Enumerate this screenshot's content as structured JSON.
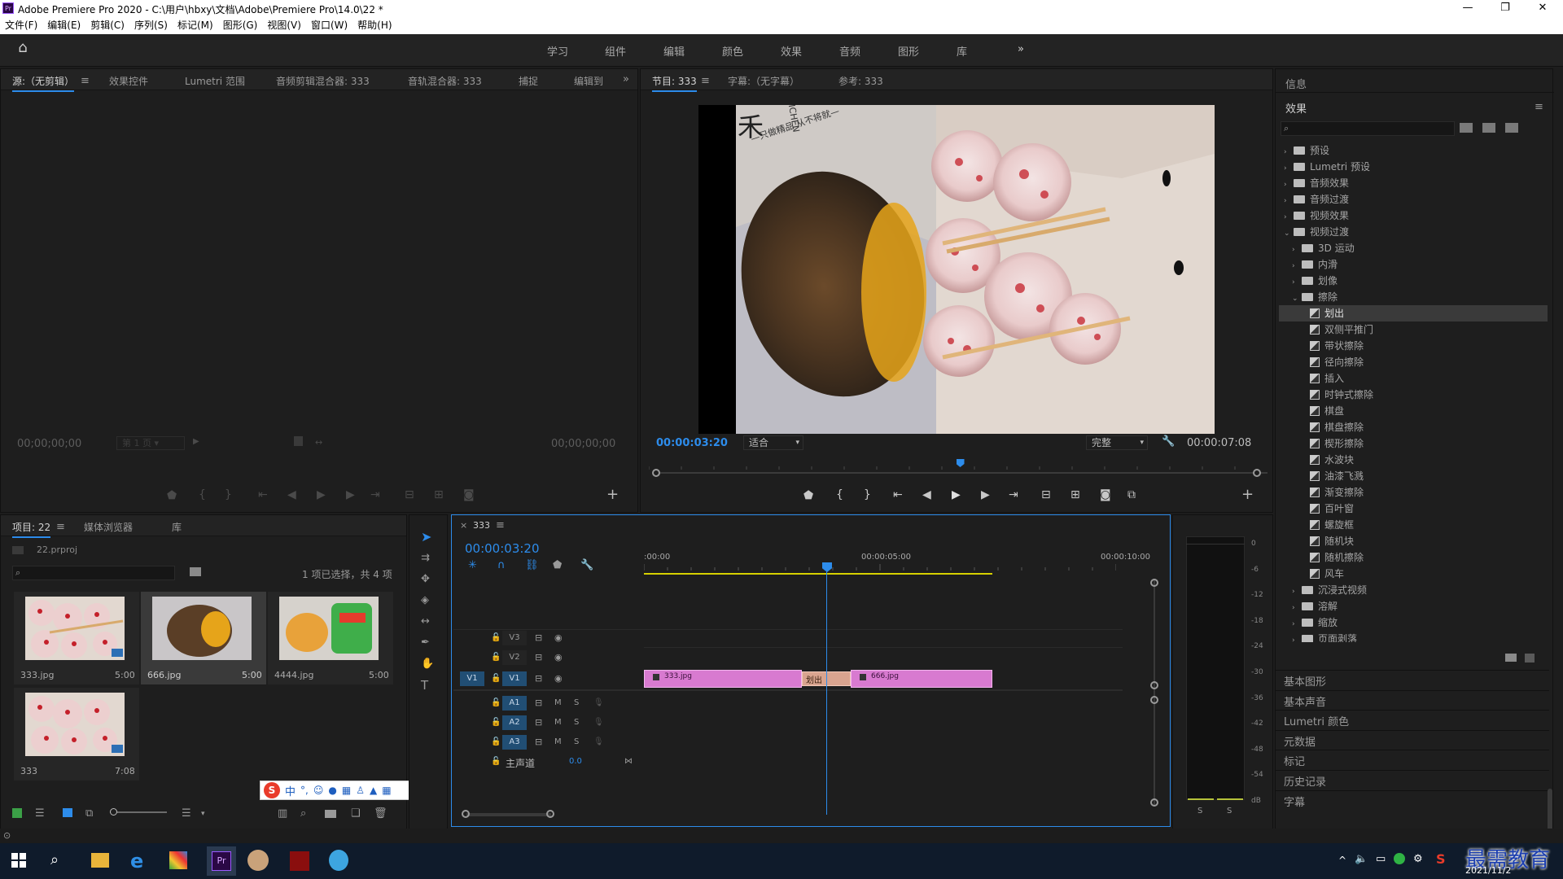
{
  "window": {
    "title": "Adobe Premiere Pro 2020 - C:\\用户\\hbxy\\文档\\Adobe\\Premiere Pro\\14.0\\22 *",
    "app_icon": "Pr"
  },
  "menu": [
    "文件(F)",
    "编辑(E)",
    "剪辑(C)",
    "序列(S)",
    "标记(M)",
    "图形(G)",
    "视图(V)",
    "窗口(W)",
    "帮助(H)"
  ],
  "workspaces": [
    "学习",
    "组件",
    "编辑",
    "颜色",
    "效果",
    "音频",
    "图形",
    "库"
  ],
  "source_panel": {
    "tabs": [
      "源:（无剪辑）",
      "效果控件",
      "Lumetri 范围",
      "音频剪辑混合器: 333",
      "音轨混合器: 333",
      "捕捉",
      "编辑到"
    ],
    "timecode_left": "00;00;00;00",
    "timecode_right": "00;00;00;00",
    "page_select": "第 1 页"
  },
  "program_panel": {
    "tabs": [
      "节目: 333",
      "字幕:（无字幕）",
      "参考: 333"
    ],
    "timecode": "00:00:03:20",
    "fit": "适合",
    "quality": "完整",
    "duration": "00:00:07:08",
    "playhead_fraction": 0.51,
    "preview_label_1": "禾",
    "preview_label_2": "—只做精品 从不将就—",
    "preview_label_3": "ICHEN"
  },
  "project_panel": {
    "tabs": [
      "项目: 22",
      "媒体浏览器",
      "库"
    ],
    "project_file": "22.prproj",
    "selection_info": "1 项已选择，共 4 项",
    "items": [
      {
        "name": "333.jpg",
        "duration": "5:00"
      },
      {
        "name": "666.jpg",
        "duration": "5:00"
      },
      {
        "name": "4444.jpg",
        "duration": "5:00"
      },
      {
        "name": "333",
        "duration": "7:08"
      }
    ],
    "ime_label": "中"
  },
  "timeline": {
    "tab": "333",
    "timecode": "00:00:03:20",
    "ruler": [
      ":00:00",
      "00:00:05:00",
      "00:00:10:00"
    ],
    "video_tracks": [
      "V3",
      "V2",
      "V1"
    ],
    "audio_tracks": [
      "A1",
      "A2",
      "A3"
    ],
    "source_patch": "V1",
    "master_label": "主声道",
    "master_value": "0.0",
    "clips": [
      {
        "name": "333.jpg"
      },
      {
        "name": "666.jpg"
      }
    ],
    "transition": "划出",
    "mute_label": "M",
    "solo_label": "S"
  },
  "meter": {
    "scale": [
      "0",
      "-6",
      "-12",
      "-18",
      "-24",
      "-30",
      "-36",
      "-42",
      "-48",
      "-54",
      "dB"
    ],
    "solo": [
      "S",
      "S"
    ]
  },
  "right_panel": {
    "info_label": "信息",
    "effects_label": "效果",
    "tree": [
      {
        "label": "预设",
        "level": 0,
        "state": "closed"
      },
      {
        "label": "Lumetri 预设",
        "level": 0,
        "state": "closed"
      },
      {
        "label": "音频效果",
        "level": 0,
        "state": "closed"
      },
      {
        "label": "音频过渡",
        "level": 0,
        "state": "closed"
      },
      {
        "label": "视频效果",
        "level": 0,
        "state": "closed"
      },
      {
        "label": "视频过渡",
        "level": 0,
        "state": "open"
      },
      {
        "label": "3D 运动",
        "level": 1,
        "state": "closed"
      },
      {
        "label": "内滑",
        "level": 1,
        "state": "closed"
      },
      {
        "label": "划像",
        "level": 1,
        "state": "closed"
      },
      {
        "label": "擦除",
        "level": 1,
        "state": "open"
      },
      {
        "label": "划出",
        "level": 2,
        "state": "item",
        "selected": true
      },
      {
        "label": "双侧平推门",
        "level": 2,
        "state": "item"
      },
      {
        "label": "带状擦除",
        "level": 2,
        "state": "item"
      },
      {
        "label": "径向擦除",
        "level": 2,
        "state": "item"
      },
      {
        "label": "插入",
        "level": 2,
        "state": "item"
      },
      {
        "label": "时钟式擦除",
        "level": 2,
        "state": "item"
      },
      {
        "label": "棋盘",
        "level": 2,
        "state": "item"
      },
      {
        "label": "棋盘擦除",
        "level": 2,
        "state": "item"
      },
      {
        "label": "楔形擦除",
        "level": 2,
        "state": "item"
      },
      {
        "label": "水波块",
        "level": 2,
        "state": "item"
      },
      {
        "label": "油漆飞溅",
        "level": 2,
        "state": "item"
      },
      {
        "label": "渐变擦除",
        "level": 2,
        "state": "item"
      },
      {
        "label": "百叶窗",
        "level": 2,
        "state": "item"
      },
      {
        "label": "螺旋框",
        "level": 2,
        "state": "item"
      },
      {
        "label": "随机块",
        "level": 2,
        "state": "item"
      },
      {
        "label": "随机擦除",
        "level": 2,
        "state": "item"
      },
      {
        "label": "风车",
        "level": 2,
        "state": "item"
      },
      {
        "label": "沉浸式视频",
        "level": 1,
        "state": "closed"
      },
      {
        "label": "溶解",
        "level": 1,
        "state": "closed"
      },
      {
        "label": "缩放",
        "level": 1,
        "state": "closed"
      },
      {
        "label": "页面剥落",
        "level": 1,
        "state": "closed"
      }
    ],
    "bottom_panels": [
      "基本图形",
      "基本声音",
      "Lumetri 颜色",
      "元数据",
      "标记",
      "历史记录",
      "字幕"
    ]
  },
  "taskbar": {
    "date": "2021/11/2",
    "watermark": "最需教育"
  }
}
